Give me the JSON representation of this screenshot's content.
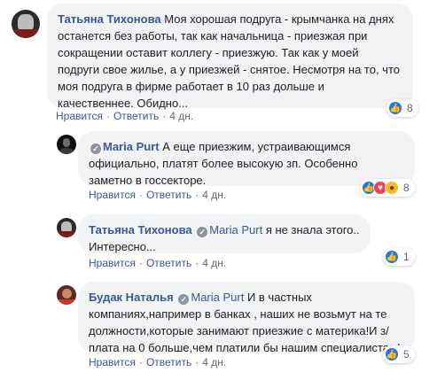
{
  "comments": [
    {
      "author": "Татьяна Тихонова",
      "mention": "",
      "text": "Моя хорошая подруга - крымчанка на днях останется без работы, так как начальница - приезжая при сокращении оставит коллегу - приезжую. Так как у моей подруги свое жилье, а у приезжей - снятое. Несмотря на то, что моя подруга в фирме работает в 10 раз дольше и качественнее. Обидно...",
      "like_label": "Нравится",
      "reply_label": "Ответить",
      "time": "4 дн.",
      "reactions": [
        "like-icon"
      ],
      "reaction_count": "8"
    },
    {
      "author": "Maria Purt",
      "mention": "",
      "text": "А еще приезжим, устраивающимся официально, платят более высокую зп. Особенно заметно в госсекторе.",
      "like_label": "Нравится",
      "reply_label": "Ответить",
      "time": "4 дн.",
      "reactions": [
        "like-icon",
        "love-icon",
        "wow-icon"
      ],
      "reaction_count": "8"
    },
    {
      "author": "Татьяна Тихонова",
      "mention": "Maria Purt",
      "text": "я не знала этого.. Интересно...",
      "like_label": "Нравится",
      "reply_label": "Ответить",
      "time": "4 дн.",
      "reactions": [
        "like-icon"
      ],
      "reaction_count": "1"
    },
    {
      "author": "Будак Наталья",
      "mention": "Maria Purt",
      "text": "И в частных компаниях,например в банках , наших не возьмут на те должности,которые занимают приезжие с материка!И з/плата на 0 больше,чем платили бы нашим специалистам!",
      "like_label": "Нравится",
      "reply_label": "Ответить",
      "time": "4 дн.",
      "reactions": [
        "like-icon"
      ],
      "reaction_count": "5"
    }
  ],
  "colors": {
    "link": "#385898",
    "bubble": "#f2f3f5",
    "like": "#1877f2",
    "love": "#f33e58",
    "wow": "#f7b928"
  }
}
